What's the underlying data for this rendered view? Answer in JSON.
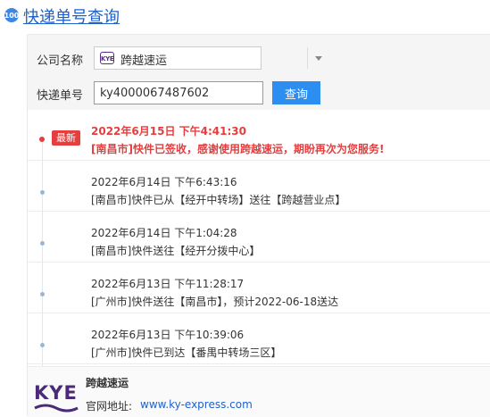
{
  "header": {
    "logo_text": "100",
    "title": "快递单号查询"
  },
  "form": {
    "company_label": "公司名称",
    "company_value": "跨越速运",
    "company_icon_text": "KYE",
    "number_label": "快递单号",
    "number_value": "ky4000067487602",
    "query_button": "查询"
  },
  "timeline": [
    {
      "badge": "最新",
      "time": "2022年6月15日 下午4:41:30",
      "desc": "[南昌市]快件已签收，感谢使用跨越速运，期盼再次为您服务!",
      "latest": true
    },
    {
      "time": "2022年6月14日 下午6:43:16",
      "desc": "[南昌市]快件已从【经开中转场】送往【跨越营业点】"
    },
    {
      "time": "2022年6月14日 下午1:04:28",
      "desc": "[南昌市]快件送往【经开分拨中心】"
    },
    {
      "time": "2022年6月13日 下午11:28:17",
      "desc": "[广州市]快件送往【南昌市】，预计2022-06-18送达"
    },
    {
      "time": "2022年6月13日 下午10:39:06",
      "desc": "[广州市]快件已到达【番禺中转场三区】"
    }
  ],
  "footer": {
    "logo_text": "KYE",
    "company_name": "跨越速运",
    "site_label": "官网地址:",
    "site_url": "www.ky-express.com"
  },
  "colors": {
    "accent": "#2d8ef2",
    "latest": "#e53e3e",
    "brand": "#4b2a7a"
  }
}
